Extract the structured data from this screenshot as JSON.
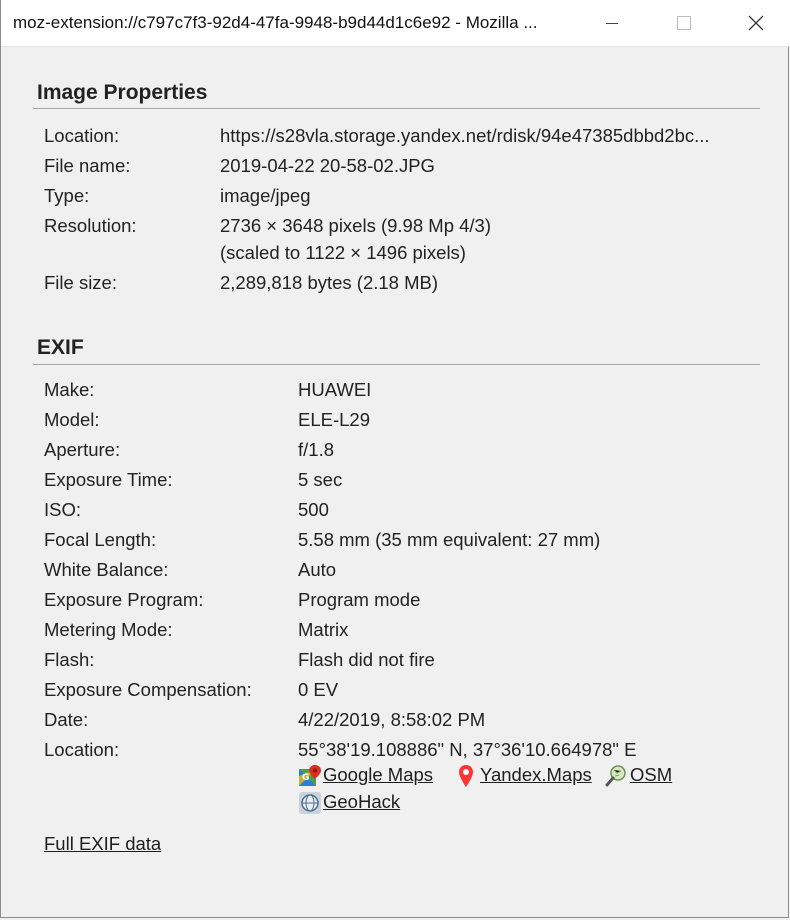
{
  "window": {
    "title": "moz-extension://c797c7f3-92d4-47fa-9948-b9d44d1c6e92 - Mozilla ..."
  },
  "image_properties": {
    "heading": "Image Properties",
    "rows": [
      {
        "label": "Location:",
        "value": "https://s28vla.storage.yandex.net/rdisk/94e47385dbbd2bc..."
      },
      {
        "label": "File name:",
        "value": "2019-04-22 20-58-02.JPG"
      },
      {
        "label": "Type:",
        "value": "image/jpeg"
      },
      {
        "label": "Resolution:",
        "value": "2736 × 3648 pixels (9.98 Mp 4/3)",
        "value2": "(scaled to 1122 × 1496 pixels)"
      },
      {
        "label": "File size:",
        "value": "2,289,818 bytes (2.18 MB)"
      }
    ]
  },
  "exif": {
    "heading": "EXIF",
    "rows": [
      {
        "label": "Make:",
        "value": "HUAWEI"
      },
      {
        "label": "Model:",
        "value": "ELE-L29"
      },
      {
        "label": "Aperture:",
        "value": "f/1.8"
      },
      {
        "label": "Exposure Time:",
        "value": "5 sec"
      },
      {
        "label": "ISO:",
        "value": "500"
      },
      {
        "label": "Focal Length:",
        "value": "5.58 mm (35 mm equivalent: 27 mm)"
      },
      {
        "label": "White Balance:",
        "value": "Auto"
      },
      {
        "label": "Exposure Program:",
        "value": "Program mode"
      },
      {
        "label": "Metering Mode:",
        "value": "Matrix"
      },
      {
        "label": "Flash:",
        "value": "Flash did not fire"
      },
      {
        "label": "Exposure Compensation:",
        "value": "0 EV"
      },
      {
        "label": "Date:",
        "value": "4/22/2019, 8:58:02 PM"
      },
      {
        "label": "Location:",
        "value": "55°38'19.108886\" N, 37°36'10.664978\" E"
      }
    ],
    "map_links": {
      "google": "Google Maps",
      "yandex": "Yandex.Maps",
      "osm": "OSM",
      "geohack": "GeoHack"
    }
  },
  "footer": {
    "full_exif_link": "Full EXIF data"
  },
  "icons": {
    "minimize": "minimize-icon",
    "maximize": "maximize-icon",
    "close": "close-icon",
    "google": "google-maps-icon",
    "yandex": "yandex-pin-icon",
    "osm": "osm-magnifier-icon",
    "geohack": "geohack-globe-icon"
  }
}
